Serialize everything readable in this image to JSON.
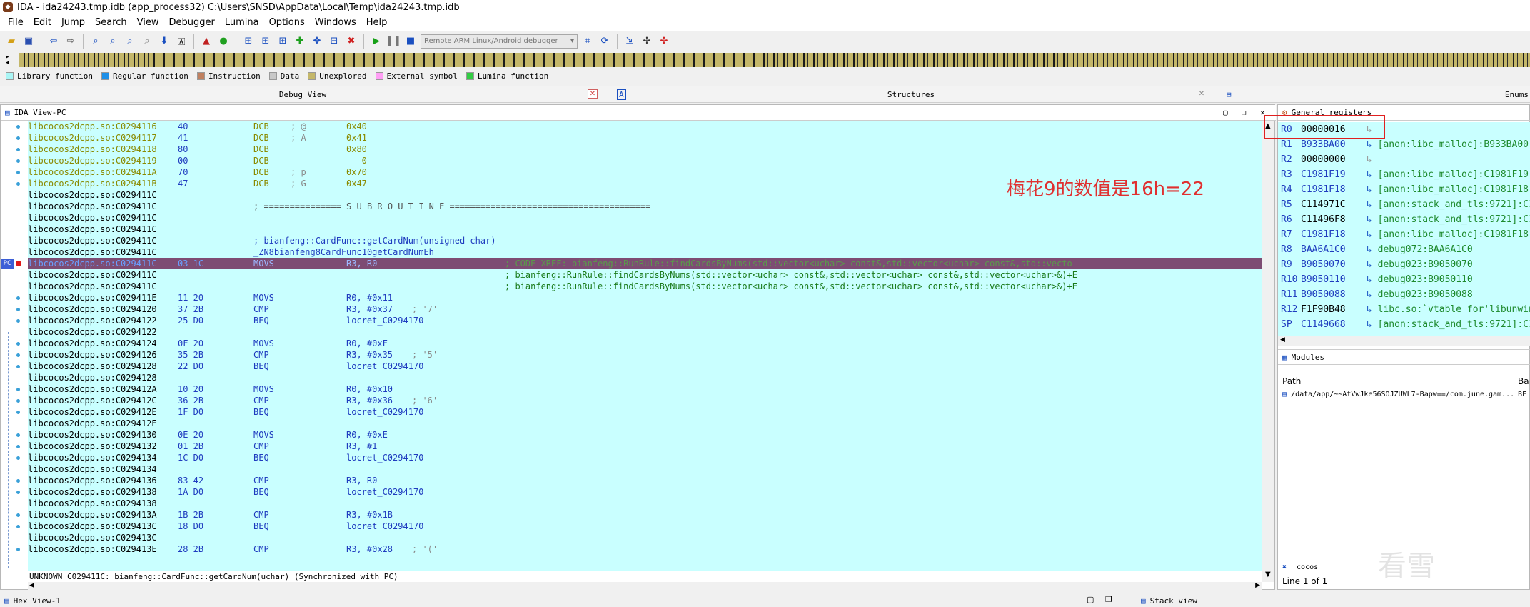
{
  "window": {
    "title": "IDA - ida24243.tmp.idb (app_process32) C:\\Users\\SNSD\\AppData\\Local\\Temp\\ida24243.tmp.idb"
  },
  "menu": [
    "File",
    "Edit",
    "Jump",
    "Search",
    "View",
    "Debugger",
    "Lumina",
    "Options",
    "Windows",
    "Help"
  ],
  "toolbar": {
    "debugger_select": "Remote ARM Linux/Android debugger"
  },
  "legend": [
    {
      "label": "Library function",
      "color": "#a9f5f5"
    },
    {
      "label": "Regular function",
      "color": "#1e90e8"
    },
    {
      "label": "Instruction",
      "color": "#c08060"
    },
    {
      "label": "Data",
      "color": "#c8c8c8"
    },
    {
      "label": "Unexplored",
      "color": "#c4b76a"
    },
    {
      "label": "External symbol",
      "color": "#ff9ef5"
    },
    {
      "label": "Lumina function",
      "color": "#33cc44"
    }
  ],
  "tabs": {
    "debug_view": "Debug View",
    "structures": "Structures",
    "enums": "Enums"
  },
  "ida_view": {
    "title": "IDA View-PC",
    "lines": [
      {
        "addr": "libcocos2dcpp.so:C0294116",
        "bytes": "40",
        "mnem": "DCB",
        "ops": "0x40",
        "cmt": "; @",
        "color": "#8a8a00"
      },
      {
        "addr": "libcocos2dcpp.so:C0294117",
        "bytes": "41",
        "mnem": "DCB",
        "ops": "0x41",
        "cmt": "; A",
        "color": "#8a8a00"
      },
      {
        "addr": "libcocos2dcpp.so:C0294118",
        "bytes": "80",
        "mnem": "DCB",
        "ops": "0x80",
        "cmt": "",
        "color": "#8a8a00"
      },
      {
        "addr": "libcocos2dcpp.so:C0294119",
        "bytes": "00",
        "mnem": "DCB",
        "ops": "   0",
        "cmt": "",
        "color": "#8a8a00"
      },
      {
        "addr": "libcocos2dcpp.so:C029411A",
        "bytes": "70",
        "mnem": "DCB",
        "ops": "0x70",
        "cmt": "; p",
        "color": "#8a8a00"
      },
      {
        "addr": "libcocos2dcpp.so:C029411B",
        "bytes": "47",
        "mnem": "DCB",
        "ops": "0x47",
        "cmt": "; G",
        "color": "#8a8a00"
      },
      {
        "addr": "libcocos2dcpp.so:C029411C",
        "bytes": "",
        "mnem": "",
        "ops": "",
        "cmt": "",
        "color": "#000"
      },
      {
        "addr": "libcocos2dcpp.so:C029411C",
        "bytes": "",
        "mnem": "",
        "ops": "",
        "cmt": "",
        "color": "#000",
        "text": "; =============== S U B R O U T I N E ======================================="
      },
      {
        "addr": "libcocos2dcpp.so:C029411C",
        "bytes": "",
        "mnem": "",
        "ops": "",
        "cmt": "",
        "color": "#000"
      },
      {
        "addr": "libcocos2dcpp.so:C029411C",
        "bytes": "",
        "mnem": "",
        "ops": "",
        "cmt": "",
        "color": "#000"
      },
      {
        "addr": "libcocos2dcpp.so:C029411C",
        "bytes": "",
        "mnem": "",
        "ops": "",
        "cmt": "",
        "color": "#000",
        "text": "; bianfeng::CardFunc::getCardNum(unsigned char)"
      },
      {
        "addr": "libcocos2dcpp.so:C029411C",
        "bytes": "",
        "mnem": "",
        "ops": "",
        "cmt": "",
        "color": "#000",
        "text": "_ZN8bianfeng8CardFunc10getCardNumEh"
      },
      {
        "addr": "libcocos2dcpp.so:C029411C",
        "bytes": "03 1C",
        "mnem": "MOVS",
        "ops": "R3, R0",
        "cmt": "; CODE XREF: bianfeng::RunRule::findCardsByNums(std::vector<uchar> const&,std::vector<uchar> const&,std::vecto",
        "color": "#000",
        "current": true
      },
      {
        "addr": "libcocos2dcpp.so:C029411C",
        "bytes": "",
        "mnem": "",
        "ops": "",
        "cmt": "; bianfeng::RunRule::findCardsByNums(std::vector<uchar> const&,std::vector<uchar> const&,std::vector<uchar>&)+E",
        "color": "#000"
      },
      {
        "addr": "libcocos2dcpp.so:C029411C",
        "bytes": "",
        "mnem": "",
        "ops": "",
        "cmt": "; bianfeng::RunRule::findCardsByNums(std::vector<uchar> const&,std::vector<uchar> const&,std::vector<uchar>&)+E",
        "color": "#000"
      },
      {
        "addr": "libcocos2dcpp.so:C029411E",
        "bytes": "11 20",
        "mnem": "MOVS",
        "ops": "R0, #0x11",
        "cmt": "",
        "color": "#000"
      },
      {
        "addr": "libcocos2dcpp.so:C0294120",
        "bytes": "37 2B",
        "mnem": "CMP",
        "ops": "R3, #0x37",
        "cmt": "; '7'",
        "color": "#000"
      },
      {
        "addr": "libcocos2dcpp.so:C0294122",
        "bytes": "25 D0",
        "mnem": "BEQ",
        "ops": "locret_C0294170",
        "cmt": "",
        "color": "#000"
      },
      {
        "addr": "libcocos2dcpp.so:C0294122",
        "bytes": "",
        "mnem": "",
        "ops": "",
        "cmt": "",
        "color": "#000"
      },
      {
        "addr": "libcocos2dcpp.so:C0294124",
        "bytes": "0F 20",
        "mnem": "MOVS",
        "ops": "R0, #0xF",
        "cmt": "",
        "color": "#000"
      },
      {
        "addr": "libcocos2dcpp.so:C0294126",
        "bytes": "35 2B",
        "mnem": "CMP",
        "ops": "R3, #0x35",
        "cmt": "; '5'",
        "color": "#000"
      },
      {
        "addr": "libcocos2dcpp.so:C0294128",
        "bytes": "22 D0",
        "mnem": "BEQ",
        "ops": "locret_C0294170",
        "cmt": "",
        "color": "#000"
      },
      {
        "addr": "libcocos2dcpp.so:C0294128",
        "bytes": "",
        "mnem": "",
        "ops": "",
        "cmt": "",
        "color": "#000"
      },
      {
        "addr": "libcocos2dcpp.so:C029412A",
        "bytes": "10 20",
        "mnem": "MOVS",
        "ops": "R0, #0x10",
        "cmt": "",
        "color": "#000"
      },
      {
        "addr": "libcocos2dcpp.so:C029412C",
        "bytes": "36 2B",
        "mnem": "CMP",
        "ops": "R3, #0x36",
        "cmt": "; '6'",
        "color": "#000"
      },
      {
        "addr": "libcocos2dcpp.so:C029412E",
        "bytes": "1F D0",
        "mnem": "BEQ",
        "ops": "locret_C0294170",
        "cmt": "",
        "color": "#000"
      },
      {
        "addr": "libcocos2dcpp.so:C029412E",
        "bytes": "",
        "mnem": "",
        "ops": "",
        "cmt": "",
        "color": "#000"
      },
      {
        "addr": "libcocos2dcpp.so:C0294130",
        "bytes": "0E 20",
        "mnem": "MOVS",
        "ops": "R0, #0xE",
        "cmt": "",
        "color": "#000"
      },
      {
        "addr": "libcocos2dcpp.so:C0294132",
        "bytes": "01 2B",
        "mnem": "CMP",
        "ops": "R3, #1",
        "cmt": "",
        "color": "#000"
      },
      {
        "addr": "libcocos2dcpp.so:C0294134",
        "bytes": "1C D0",
        "mnem": "BEQ",
        "ops": "locret_C0294170",
        "cmt": "",
        "color": "#000"
      },
      {
        "addr": "libcocos2dcpp.so:C0294134",
        "bytes": "",
        "mnem": "",
        "ops": "",
        "cmt": "",
        "color": "#000"
      },
      {
        "addr": "libcocos2dcpp.so:C0294136",
        "bytes": "83 42",
        "mnem": "CMP",
        "ops": "R3, R0",
        "cmt": "",
        "color": "#000"
      },
      {
        "addr": "libcocos2dcpp.so:C0294138",
        "bytes": "1A D0",
        "mnem": "BEQ",
        "ops": "locret_C0294170",
        "cmt": "",
        "color": "#000"
      },
      {
        "addr": "libcocos2dcpp.so:C0294138",
        "bytes": "",
        "mnem": "",
        "ops": "",
        "cmt": "",
        "color": "#000"
      },
      {
        "addr": "libcocos2dcpp.so:C029413A",
        "bytes": "1B 2B",
        "mnem": "CMP",
        "ops": "R3, #0x1B",
        "cmt": "",
        "color": "#000"
      },
      {
        "addr": "libcocos2dcpp.so:C029413C",
        "bytes": "18 D0",
        "mnem": "BEQ",
        "ops": "locret_C0294170",
        "cmt": "",
        "color": "#000"
      },
      {
        "addr": "libcocos2dcpp.so:C029413C",
        "bytes": "",
        "mnem": "",
        "ops": "",
        "cmt": "",
        "color": "#000"
      },
      {
        "addr": "libcocos2dcpp.so:C029413E",
        "bytes": "28 2B",
        "mnem": "CMP",
        "ops": "R3, #0x28",
        "cmt": "; '('",
        "color": "#000"
      }
    ],
    "status": "UNKNOWN C029411C: bianfeng::CardFunc::getCardNum(uchar) (Synchronized with PC)",
    "pc_label": "PC"
  },
  "registers": {
    "title": "General registers",
    "items": [
      {
        "name": "R0",
        "value": "00000016",
        "desc": ""
      },
      {
        "name": "R1",
        "value": "B933BA00",
        "desc": "[anon:libc_malloc]:B933BA00"
      },
      {
        "name": "R2",
        "value": "00000000",
        "desc": ""
      },
      {
        "name": "R3",
        "value": "C1981F19",
        "desc": "[anon:libc_malloc]:C1981F19"
      },
      {
        "name": "R4",
        "value": "C1981F18",
        "desc": "[anon:libc_malloc]:C1981F18"
      },
      {
        "name": "R5",
        "value": "C114971C",
        "desc": "[anon:stack_and_tls:9721]:C11"
      },
      {
        "name": "R6",
        "value": "C11496F8",
        "desc": "[anon:stack_and_tls:9721]:C11"
      },
      {
        "name": "R7",
        "value": "C1981F18",
        "desc": "[anon:libc_malloc]:C1981F18"
      },
      {
        "name": "R8",
        "value": "BAA6A1C0",
        "desc": "debug072:BAA6A1C0"
      },
      {
        "name": "R9",
        "value": "B9050070",
        "desc": "debug023:B9050070"
      },
      {
        "name": "R10",
        "value": "B9050110",
        "desc": "debug023:B9050110"
      },
      {
        "name": "R11",
        "value": "B9050088",
        "desc": "debug023:B9050088"
      },
      {
        "name": "R12",
        "value": "F1F90B48",
        "desc": "libc.so:`vtable for'libunwind"
      },
      {
        "name": "SP",
        "value": "C1149668",
        "desc": "[anon:stack_and_tls:9721]:C11"
      }
    ]
  },
  "modules": {
    "title": "Modules",
    "col_path": "Path",
    "col_base": "Ba",
    "row_path": "/data/app/~~AtVwJke56SOJZUWL7-Bapw==/com.june.gam...",
    "row_base": "BF",
    "search": "cocos",
    "count": "Line 1 of 1"
  },
  "bottom_tabs": {
    "hex": "Hex View-1",
    "stack": "Stack view"
  },
  "annotation": "梅花9的数值是16h=22",
  "watermark": "看雪"
}
